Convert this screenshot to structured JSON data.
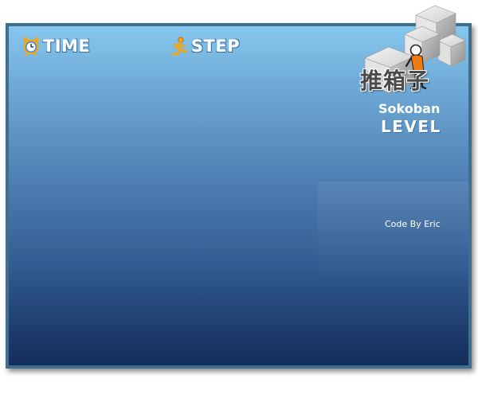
{
  "hud": {
    "time_label": "TIME",
    "step_label": "STEP",
    "time_icon": "alarm-clock-icon",
    "step_icon": "running-figure-icon"
  },
  "branding": {
    "logo_text": "推箱子",
    "game_name": "Sokoban",
    "level_label": "LEVEL",
    "credits": "Code By Eric"
  },
  "colors": {
    "frame_border": "#3f6f8c",
    "background_top": "#86c7ee",
    "background_bottom": "#152f5c",
    "icon_accent": "#f2a51a",
    "figure_shirt": "#f07a12"
  }
}
